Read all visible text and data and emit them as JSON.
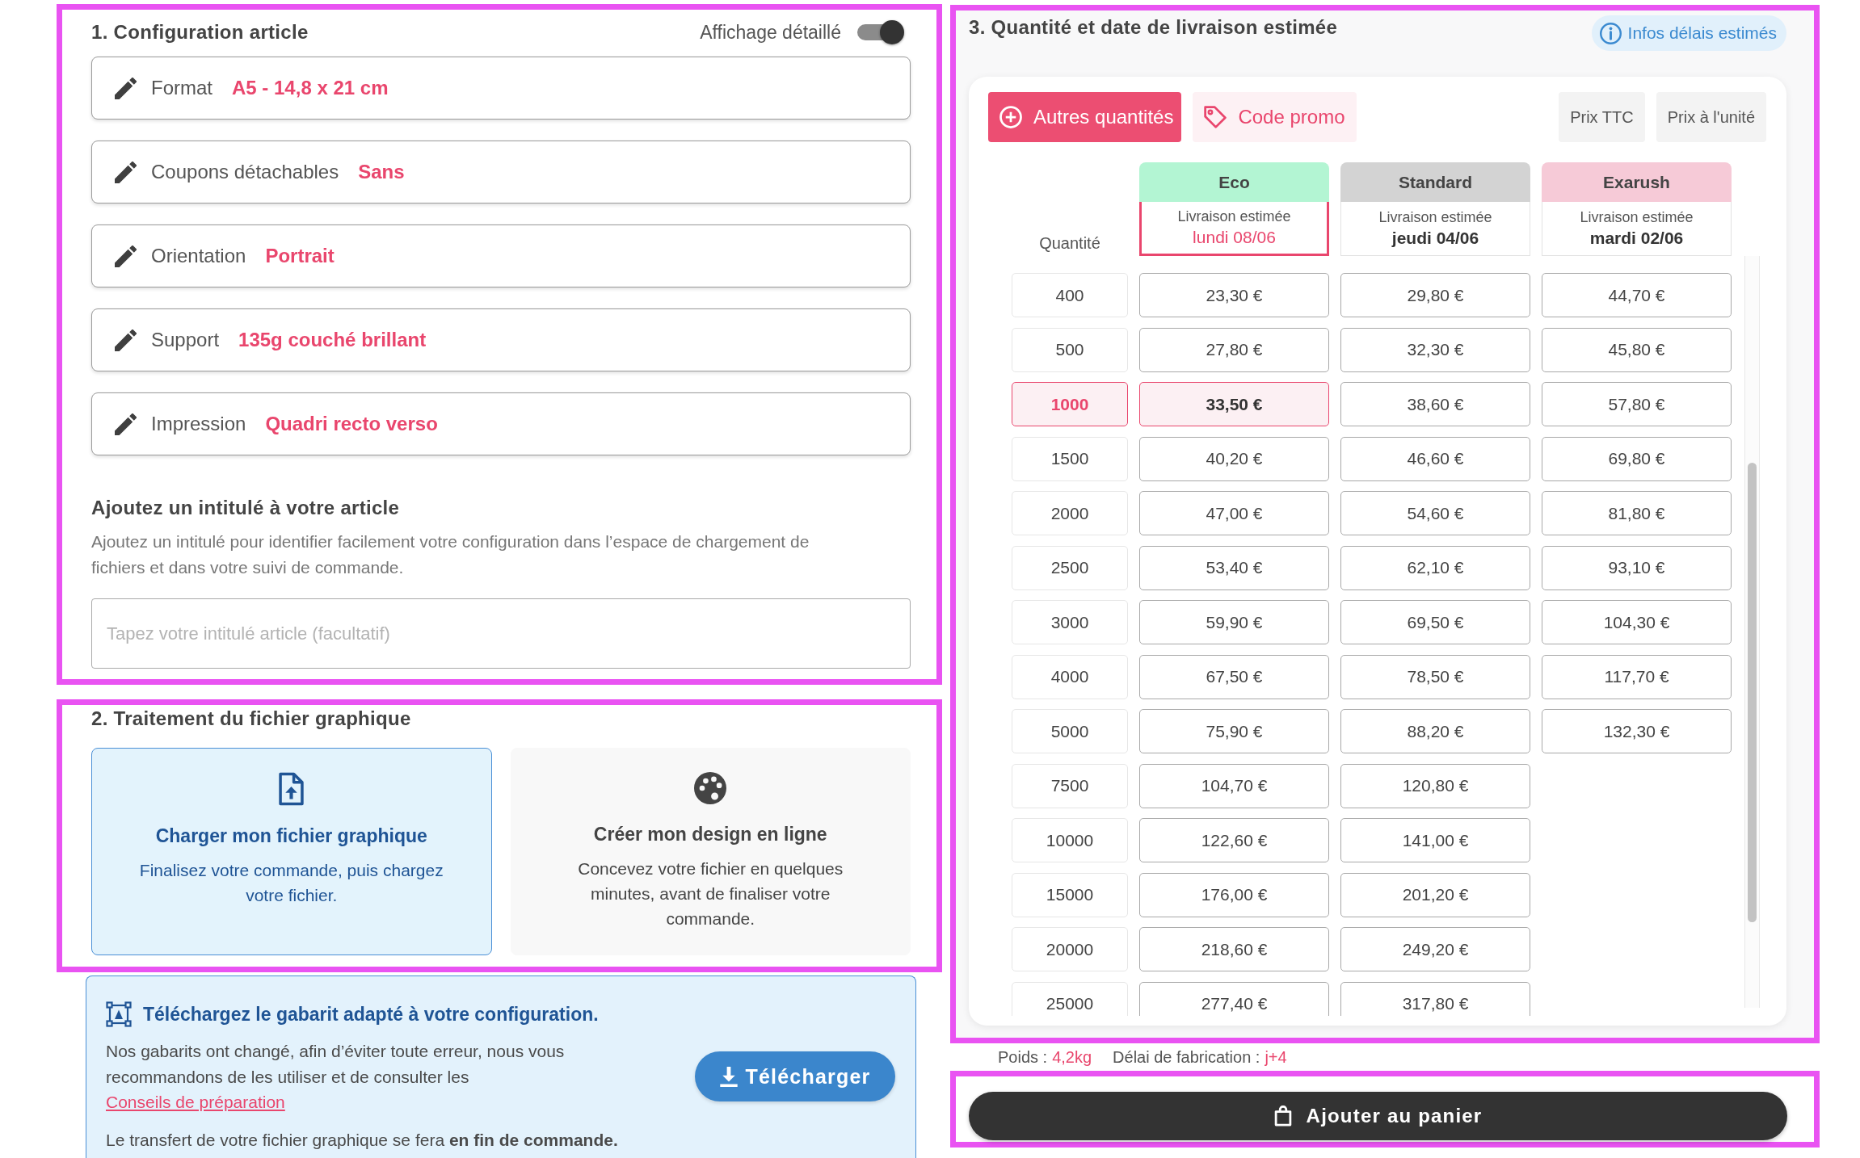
{
  "config": {
    "title": "1. Configuration article",
    "detail_toggle": {
      "label": "Affichage détaillé",
      "on": true
    },
    "options": [
      {
        "label": "Format",
        "value": "A5 - 14,8 x 21 cm"
      },
      {
        "label": "Coupons détachables",
        "value": "Sans"
      },
      {
        "label": "Orientation",
        "value": "Portrait"
      },
      {
        "label": "Support",
        "value": "135g couché brillant"
      },
      {
        "label": "Impression",
        "value": "Quadri recto verso"
      }
    ],
    "article_title": {
      "heading": "Ajoutez un intitulé à votre article",
      "description": "Ajoutez un intitulé pour identifier facilement votre configuration dans l’espace de chargement de fichiers et dans votre suivi de commande.",
      "placeholder": "Tapez votre intitulé article (facultatif)"
    }
  },
  "file_processing": {
    "title": "2. Traitement du fichier graphique",
    "choices": [
      {
        "kind": "upload",
        "title": "Charger mon fichier graphique",
        "text": "Finalisez votre commande, puis chargez votre fichier.",
        "selected": true
      },
      {
        "kind": "design",
        "title": "Créer mon design en ligne",
        "text": "Concevez votre fichier en quelques minutes, avant de finaliser votre commande.",
        "selected": false
      }
    ]
  },
  "template_notice": {
    "title": "Téléchargez le gabarit adapté à votre configuration.",
    "text": "Nos gabarits ont changé, afin d’éviter toute erreur, nous vous recommandons de les utiliser et de consulter les",
    "link": "Conseils de préparation",
    "button": "Télécharger",
    "note": "Le transfert de votre fichier graphique se fera **en fin de commande.**"
  },
  "pricing": {
    "title": "3. Quantité et date de livraison estimée",
    "info_button": "Infos délais estimés",
    "toolbar": [
      {
        "kind": "add",
        "label": "Autres quantités"
      },
      {
        "kind": "promo",
        "label": "Code promo"
      },
      {
        "kind": "option",
        "label": "Prix TTC"
      },
      {
        "kind": "option",
        "label": "Prix à l'unité"
      }
    ],
    "quantity_header": "Quantité",
    "speeds": [
      {
        "name": "Eco",
        "color": "#b3f5d3",
        "delivery_label": "Livraison estimée",
        "date": "lundi 08/06",
        "selected": true
      },
      {
        "name": "Standard",
        "color": "#d3d3d3",
        "delivery_label": "Livraison estimée",
        "date": "jeudi 04/06",
        "selected": false
      },
      {
        "name": "Exarush",
        "color": "#f6cad7",
        "delivery_label": "Livraison estimée",
        "date": "mardi 02/06",
        "selected": false
      }
    ],
    "rows": [
      {
        "quantity": "400",
        "selected": false,
        "prices": [
          {
            "price": "23,30 €",
            "selected": false
          },
          {
            "price": "29,80 €",
            "selected": false
          },
          {
            "price": "44,70 €",
            "selected": false
          }
        ]
      },
      {
        "quantity": "500",
        "selected": false,
        "prices": [
          {
            "price": "27,80 €",
            "selected": false
          },
          {
            "price": "32,30 €",
            "selected": false
          },
          {
            "price": "45,80 €",
            "selected": false
          }
        ]
      },
      {
        "quantity": "1000",
        "selected": true,
        "prices": [
          {
            "price": "33,50 €",
            "selected": true
          },
          {
            "price": "38,60 €",
            "selected": false
          },
          {
            "price": "57,80 €",
            "selected": false
          }
        ]
      },
      {
        "quantity": "1500",
        "selected": false,
        "prices": [
          {
            "price": "40,20 €",
            "selected": false
          },
          {
            "price": "46,60 €",
            "selected": false
          },
          {
            "price": "69,80 €",
            "selected": false
          }
        ]
      },
      {
        "quantity": "2000",
        "selected": false,
        "prices": [
          {
            "price": "47,00 €",
            "selected": false
          },
          {
            "price": "54,60 €",
            "selected": false
          },
          {
            "price": "81,80 €",
            "selected": false
          }
        ]
      },
      {
        "quantity": "2500",
        "selected": false,
        "prices": [
          {
            "price": "53,40 €",
            "selected": false
          },
          {
            "price": "62,10 €",
            "selected": false
          },
          {
            "price": "93,10 €",
            "selected": false
          }
        ]
      },
      {
        "quantity": "3000",
        "selected": false,
        "prices": [
          {
            "price": "59,90 €",
            "selected": false
          },
          {
            "price": "69,50 €",
            "selected": false
          },
          {
            "price": "104,30 €",
            "selected": false
          }
        ]
      },
      {
        "quantity": "4000",
        "selected": false,
        "prices": [
          {
            "price": "67,50 €",
            "selected": false
          },
          {
            "price": "78,50 €",
            "selected": false
          },
          {
            "price": "117,70 €",
            "selected": false
          }
        ]
      },
      {
        "quantity": "5000",
        "selected": false,
        "prices": [
          {
            "price": "75,90 €",
            "selected": false
          },
          {
            "price": "88,20 €",
            "selected": false
          },
          {
            "price": "132,30 €",
            "selected": false
          }
        ]
      },
      {
        "quantity": "7500",
        "selected": false,
        "prices": [
          {
            "price": "104,70 €",
            "selected": false
          },
          {
            "price": "120,80 €",
            "selected": false
          }
        ]
      },
      {
        "quantity": "10000",
        "selected": false,
        "prices": [
          {
            "price": "122,60 €",
            "selected": false
          },
          {
            "price": "141,00 €",
            "selected": false
          }
        ]
      },
      {
        "quantity": "15000",
        "selected": false,
        "prices": [
          {
            "price": "176,00 €",
            "selected": false
          },
          {
            "price": "201,20 €",
            "selected": false
          }
        ]
      },
      {
        "quantity": "20000",
        "selected": false,
        "prices": [
          {
            "price": "218,60 €",
            "selected": false
          },
          {
            "price": "249,20 €",
            "selected": false
          }
        ]
      },
      {
        "quantity": "25000",
        "selected": false,
        "prices": [
          {
            "price": "277,40 €",
            "selected": false
          },
          {
            "price": "317,80 €",
            "selected": false
          }
        ]
      }
    ]
  },
  "summary": {
    "weight_label": "Poids :",
    "weight": "4,2kg",
    "lead_label": "Délai de fabrication :",
    "lead": "j+4"
  },
  "cart_button": "Ajouter au panier"
}
